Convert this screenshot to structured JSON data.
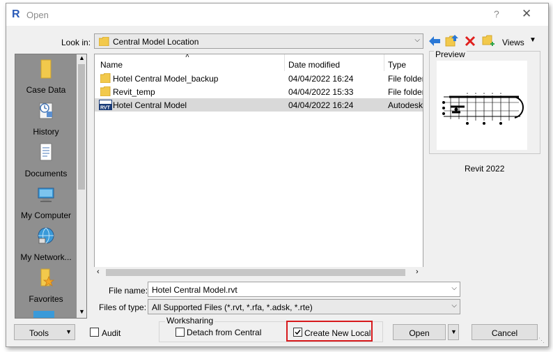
{
  "window": {
    "title": "Open",
    "help": "?",
    "close": "✕"
  },
  "look_in": {
    "label": "Look in:",
    "value": "Central Model Location"
  },
  "toolbar": {
    "views_label": "Views"
  },
  "sidebar": {
    "items": [
      {
        "label": "Case Data"
      },
      {
        "label": "History"
      },
      {
        "label": "Documents"
      },
      {
        "label": "My Computer"
      },
      {
        "label": "My Network..."
      },
      {
        "label": "Favorites"
      }
    ]
  },
  "filelist": {
    "columns": [
      "Name",
      "Date modified",
      "Type"
    ],
    "rows": [
      {
        "name": "Hotel Central Model_backup",
        "date": "04/04/2022 16:24",
        "type": "File folder",
        "icon": "folder-icon"
      },
      {
        "name": "Revit_temp",
        "date": "04/04/2022 15:33",
        "type": "File folder",
        "icon": "folder-icon"
      },
      {
        "name": "Hotel Central Model",
        "date": "04/04/2022 16:24",
        "type": "Autodesk",
        "icon": "rvt-file-icon",
        "selected": true
      }
    ]
  },
  "preview": {
    "label": "Preview",
    "version": "Revit 2022"
  },
  "file_name": {
    "label": "File name:",
    "value": "Hotel Central Model.rvt"
  },
  "file_type": {
    "label": "Files of type:",
    "value": "All Supported Files  (*.rvt, *.rfa, *.adsk, *.rte)"
  },
  "bottom": {
    "tools_label": "Tools",
    "audit_label": "Audit",
    "audit_checked": false,
    "worksharing_label": "Worksharing",
    "detach_label": "Detach from Central",
    "detach_checked": false,
    "create_local_label": "Create New Local",
    "create_local_checked": true,
    "open_label": "Open",
    "cancel_label": "Cancel"
  },
  "colors": {
    "accent": "#2a5bb8",
    "highlight": "#d7191c",
    "selection": "#d9d9d9",
    "sidebar": "#8f8f8f",
    "folder": "#f2c94c"
  }
}
